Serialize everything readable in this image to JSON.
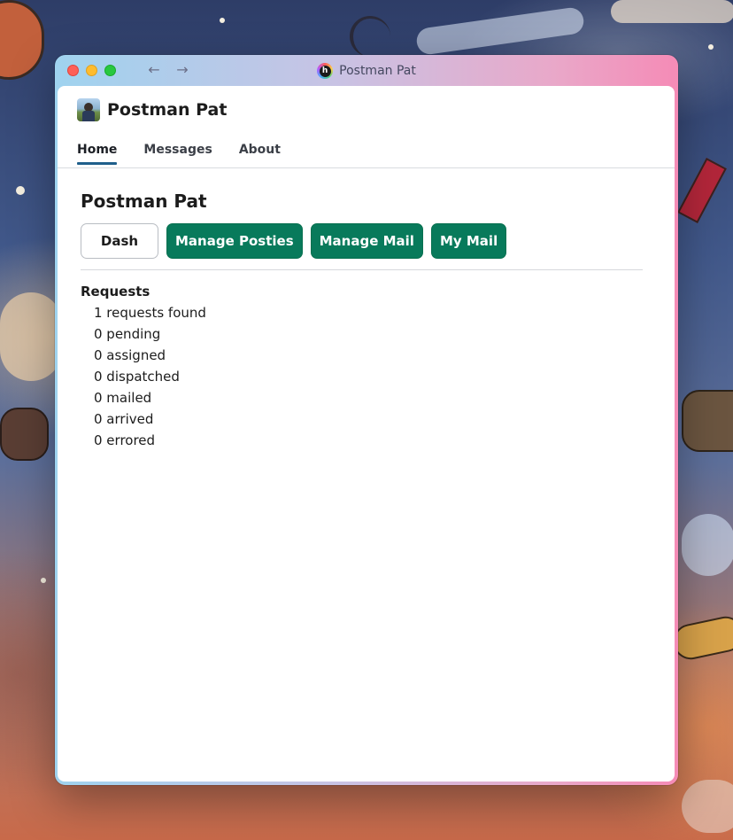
{
  "window": {
    "title": "Postman Pat",
    "app_icon_letter": "h",
    "back_glyph": "←",
    "forward_glyph": "→"
  },
  "app": {
    "name": "Postman Pat"
  },
  "tabs": [
    {
      "label": "Home",
      "active": true
    },
    {
      "label": "Messages",
      "active": false
    },
    {
      "label": "About",
      "active": false
    }
  ],
  "page": {
    "title": "Postman Pat"
  },
  "buttons": {
    "dash": "Dash",
    "manage_posties": "Manage Posties",
    "manage_mail": "Manage Mail",
    "my_mail": "My Mail"
  },
  "requests": {
    "heading": "Requests",
    "found": "1 requests found",
    "pending": "0 pending",
    "assigned": "0 assigned",
    "dispatched": "0 dispatched",
    "mailed": "0 mailed",
    "arrived": "0 arrived",
    "errored": "0 errored"
  },
  "colors": {
    "primary_button": "#087a5b",
    "active_tab_underline": "#1f5f8b",
    "traffic_red": "#fe5f57",
    "traffic_yellow": "#febc2e",
    "traffic_green": "#28c840"
  }
}
